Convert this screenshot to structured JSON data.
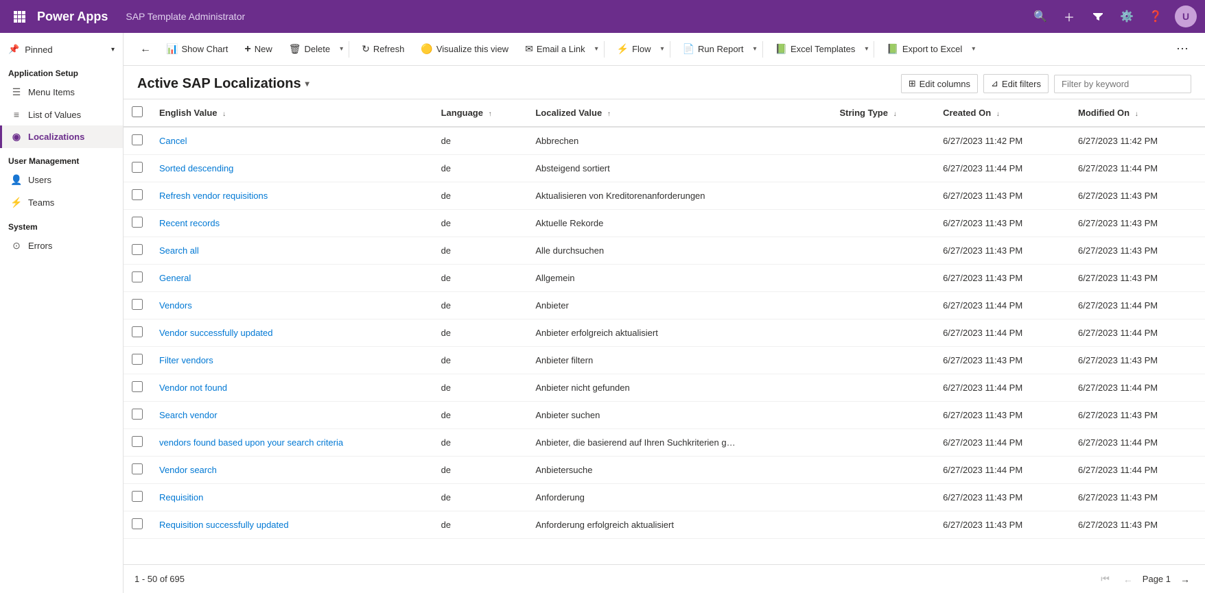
{
  "topbar": {
    "app_name": "Power Apps",
    "title": "SAP Template Administrator",
    "icons": [
      "search",
      "plus",
      "filter",
      "settings",
      "help"
    ],
    "avatar_initials": "U"
  },
  "sidebar": {
    "collapse_label": "Pinned",
    "sections": [
      {
        "header": "Application Setup",
        "items": [
          {
            "id": "menu-items",
            "label": "Menu Items",
            "icon": "☰",
            "active": false
          },
          {
            "id": "list-of-values",
            "label": "List of Values",
            "icon": "≡",
            "active": false
          },
          {
            "id": "localizations",
            "label": "Localizations",
            "icon": "◉",
            "active": true
          }
        ]
      },
      {
        "header": "User Management",
        "items": [
          {
            "id": "users",
            "label": "Users",
            "icon": "👤",
            "active": false
          },
          {
            "id": "teams",
            "label": "Teams",
            "icon": "⚡",
            "active": false
          }
        ]
      },
      {
        "header": "System",
        "items": [
          {
            "id": "errors",
            "label": "Errors",
            "icon": "⊙",
            "active": false
          }
        ]
      }
    ]
  },
  "command_bar": {
    "back_title": "Back",
    "buttons": [
      {
        "id": "show-chart",
        "label": "Show Chart",
        "icon": "📊",
        "has_chevron": false
      },
      {
        "id": "new",
        "label": "New",
        "icon": "+",
        "has_chevron": false
      },
      {
        "id": "delete",
        "label": "Delete",
        "icon": "🗑",
        "has_chevron": true
      },
      {
        "id": "refresh",
        "label": "Refresh",
        "icon": "↻",
        "has_chevron": false
      },
      {
        "id": "visualize",
        "label": "Visualize this view",
        "icon": "🟡",
        "has_chevron": false
      },
      {
        "id": "email-link",
        "label": "Email a Link",
        "icon": "✉",
        "has_chevron": true
      },
      {
        "id": "flow",
        "label": "Flow",
        "icon": "⚡",
        "has_chevron": true
      },
      {
        "id": "run-report",
        "label": "Run Report",
        "icon": "📄",
        "has_chevron": true
      },
      {
        "id": "excel-templates",
        "label": "Excel Templates",
        "icon": "📗",
        "has_chevron": true
      },
      {
        "id": "export-to-excel",
        "label": "Export to Excel",
        "icon": "📗",
        "has_chevron": true
      }
    ]
  },
  "page": {
    "title": "Active SAP Localizations",
    "edit_columns_label": "Edit columns",
    "edit_filters_label": "Edit filters",
    "filter_placeholder": "Filter by keyword"
  },
  "table": {
    "columns": [
      {
        "id": "english-value",
        "label": "English Value",
        "sort": "desc"
      },
      {
        "id": "language",
        "label": "Language",
        "sort": "asc"
      },
      {
        "id": "localized-value",
        "label": "Localized Value",
        "sort": "asc"
      },
      {
        "id": "string-type",
        "label": "String Type",
        "sort": "none"
      },
      {
        "id": "created-on",
        "label": "Created On",
        "sort": "desc"
      },
      {
        "id": "modified-on",
        "label": "Modified On",
        "sort": "desc"
      }
    ],
    "rows": [
      {
        "english_value": "Cancel",
        "language": "de",
        "localized_value": "Abbrechen",
        "string_type": "",
        "created_on": "6/27/2023 11:42 PM",
        "modified_on": "6/27/2023 11:42 PM"
      },
      {
        "english_value": "Sorted descending",
        "language": "de",
        "localized_value": "Absteigend sortiert",
        "string_type": "",
        "created_on": "6/27/2023 11:44 PM",
        "modified_on": "6/27/2023 11:44 PM"
      },
      {
        "english_value": "Refresh vendor requisitions",
        "language": "de",
        "localized_value": "Aktualisieren von Kreditorenanforderungen",
        "string_type": "",
        "created_on": "6/27/2023 11:43 PM",
        "modified_on": "6/27/2023 11:43 PM"
      },
      {
        "english_value": "Recent records",
        "language": "de",
        "localized_value": "Aktuelle Rekorde",
        "string_type": "",
        "created_on": "6/27/2023 11:43 PM",
        "modified_on": "6/27/2023 11:43 PM"
      },
      {
        "english_value": "Search all",
        "language": "de",
        "localized_value": "Alle durchsuchen",
        "string_type": "",
        "created_on": "6/27/2023 11:43 PM",
        "modified_on": "6/27/2023 11:43 PM"
      },
      {
        "english_value": "General",
        "language": "de",
        "localized_value": "Allgemein",
        "string_type": "",
        "created_on": "6/27/2023 11:43 PM",
        "modified_on": "6/27/2023 11:43 PM"
      },
      {
        "english_value": "Vendors",
        "language": "de",
        "localized_value": "Anbieter",
        "string_type": "",
        "created_on": "6/27/2023 11:44 PM",
        "modified_on": "6/27/2023 11:44 PM"
      },
      {
        "english_value": "Vendor successfully updated",
        "language": "de",
        "localized_value": "Anbieter erfolgreich aktualisiert",
        "string_type": "",
        "created_on": "6/27/2023 11:44 PM",
        "modified_on": "6/27/2023 11:44 PM"
      },
      {
        "english_value": "Filter vendors",
        "language": "de",
        "localized_value": "Anbieter filtern",
        "string_type": "",
        "created_on": "6/27/2023 11:43 PM",
        "modified_on": "6/27/2023 11:43 PM"
      },
      {
        "english_value": "Vendor not found",
        "language": "de",
        "localized_value": "Anbieter nicht gefunden",
        "string_type": "",
        "created_on": "6/27/2023 11:44 PM",
        "modified_on": "6/27/2023 11:44 PM"
      },
      {
        "english_value": "Search vendor",
        "language": "de",
        "localized_value": "Anbieter suchen",
        "string_type": "",
        "created_on": "6/27/2023 11:43 PM",
        "modified_on": "6/27/2023 11:43 PM"
      },
      {
        "english_value": "vendors found based upon your search criteria",
        "language": "de",
        "localized_value": "Anbieter, die basierend auf Ihren Suchkriterien g…",
        "string_type": "",
        "created_on": "6/27/2023 11:44 PM",
        "modified_on": "6/27/2023 11:44 PM"
      },
      {
        "english_value": "Vendor search",
        "language": "de",
        "localized_value": "Anbietersuche",
        "string_type": "",
        "created_on": "6/27/2023 11:44 PM",
        "modified_on": "6/27/2023 11:44 PM"
      },
      {
        "english_value": "Requisition",
        "language": "de",
        "localized_value": "Anforderung",
        "string_type": "",
        "created_on": "6/27/2023 11:43 PM",
        "modified_on": "6/27/2023 11:43 PM"
      },
      {
        "english_value": "Requisition successfully updated",
        "language": "de",
        "localized_value": "Anforderung erfolgreich aktualisiert",
        "string_type": "",
        "created_on": "6/27/2023 11:43 PM",
        "modified_on": "6/27/2023 11:43 PM"
      }
    ]
  },
  "footer": {
    "record_info": "1 - 50 of 695",
    "page_label": "Page 1"
  }
}
